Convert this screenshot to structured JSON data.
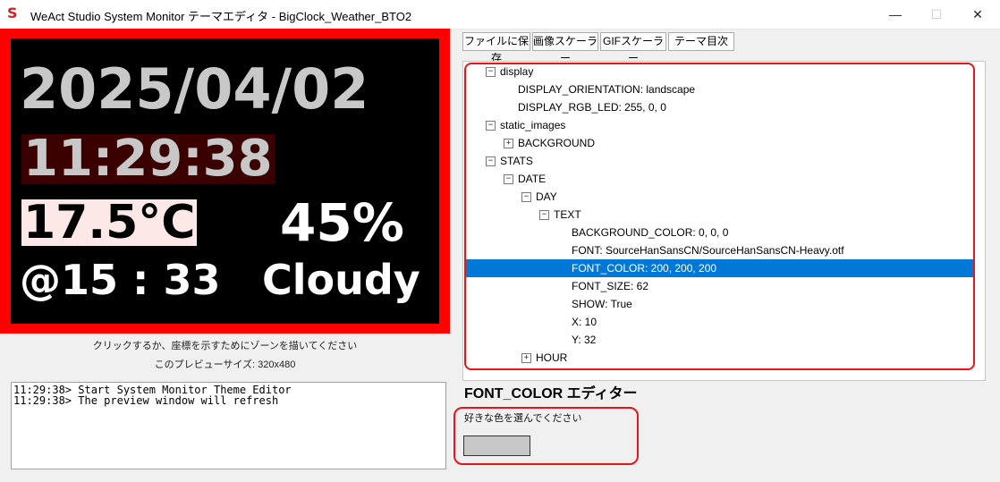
{
  "window": {
    "icon_letter": "S",
    "title": "WeAct Studio System Monitor テーマエディタ - BigClock_Weather_BTO2",
    "minimize": "—",
    "maximize": "☐",
    "close": "✕"
  },
  "preview": {
    "date": "2025/04/02",
    "time": "11:29:38",
    "temperature": "17.5°C",
    "humidity": "45%",
    "update_time": "@15 : 33",
    "condition": "Cloudy",
    "hint": "クリックするか、座標を示すためにゾーンを描いてください",
    "size_label": "このプレビューサイズ: 320x480",
    "colors": {
      "frame": "#ff0000",
      "date": "#c8c8c8",
      "time_bg": "#3a0000",
      "temp_bg": "#fde8e8"
    }
  },
  "log": {
    "lines": [
      "11:29:38> Start System Monitor Theme Editor",
      "11:29:38> The preview window will refresh"
    ]
  },
  "toolbar": {
    "save": "ファイルに保存",
    "image_scaler": "画像スケーラー",
    "gif_scaler": "GIFスケーラー",
    "theme_index": "テーマ目次"
  },
  "tree": {
    "nodes": [
      {
        "label": "display",
        "expander": "−"
      },
      {
        "label": "DISPLAY_ORIENTATION: landscape"
      },
      {
        "label": "DISPLAY_RGB_LED: 255, 0, 0"
      },
      {
        "label": "static_images",
        "expander": "−"
      },
      {
        "label": "BACKGROUND",
        "expander": "+"
      },
      {
        "label": "STATS",
        "expander": "−"
      },
      {
        "label": "DATE",
        "expander": "−"
      },
      {
        "label": "DAY",
        "expander": "−"
      },
      {
        "label": "TEXT",
        "expander": "−"
      },
      {
        "label": "BACKGROUND_COLOR: 0, 0, 0"
      },
      {
        "label": "FONT: SourceHanSansCN/SourceHanSansCN-Heavy.otf"
      },
      {
        "label": "FONT_COLOR: 200, 200, 200",
        "selected": true
      },
      {
        "label": "FONT_SIZE: 62"
      },
      {
        "label": "SHOW: True"
      },
      {
        "label": "X: 10"
      },
      {
        "label": "Y: 32"
      },
      {
        "label": "HOUR",
        "expander": "+"
      }
    ]
  },
  "editor": {
    "title": "FONT_COLOR エディター",
    "prompt": "好きな色を選んでください",
    "color": "#c8c8c8"
  }
}
